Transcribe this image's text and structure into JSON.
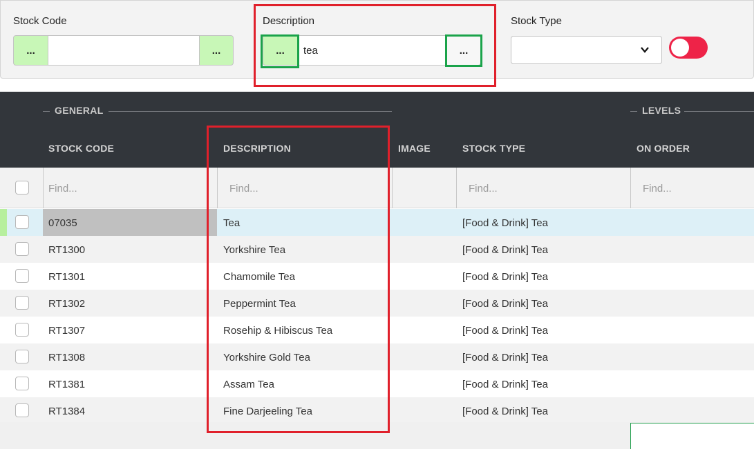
{
  "filters": {
    "stock_code": {
      "label": "Stock Code",
      "btn_left": "...",
      "btn_right": "...",
      "value": ""
    },
    "description": {
      "label": "Description",
      "btn_left": "...",
      "btn_right": "...",
      "value": "tea"
    },
    "stock_type": {
      "label": "Stock Type",
      "value": ""
    },
    "toggle": {
      "state": "off",
      "color": "#ee2348"
    }
  },
  "grid": {
    "groups": {
      "general": "GENERAL",
      "levels": "LEVELS"
    },
    "columns": {
      "stock_code": "STOCK CODE",
      "description": "DESCRIPTION",
      "image": "IMAGE",
      "stock_type": "STOCK TYPE",
      "on_order": "ON ORDER"
    },
    "find_placeholder": "Find...",
    "rows": [
      {
        "code": "07035",
        "description": "Tea",
        "stock_type": "[Food & Drink] Tea",
        "selected": true
      },
      {
        "code": "RT1300",
        "description": "Yorkshire Tea",
        "stock_type": "[Food & Drink] Tea"
      },
      {
        "code": "RT1301",
        "description": "Chamomile Tea",
        "stock_type": "[Food & Drink] Tea"
      },
      {
        "code": "RT1302",
        "description": "Peppermint Tea",
        "stock_type": "[Food & Drink] Tea"
      },
      {
        "code": "RT1307",
        "description": "Rosehip & Hibiscus Tea",
        "stock_type": "[Food & Drink] Tea"
      },
      {
        "code": "RT1308",
        "description": "Yorkshire Gold Tea",
        "stock_type": "[Food & Drink] Tea"
      },
      {
        "code": "RT1381",
        "description": "Assam Tea",
        "stock_type": "[Food & Drink] Tea"
      },
      {
        "code": "RT1384",
        "description": "Fine Darjeeling Tea",
        "stock_type": "[Food & Drink] Tea"
      }
    ]
  },
  "colors": {
    "header_bg": "#32363b",
    "selected_row_bg": "#ddf0f7",
    "selected_code_bg": "#c0c0c0",
    "button_green": "#c8f7b7",
    "annotation_red": "#e0202b",
    "annotation_green": "#1aa34a"
  }
}
